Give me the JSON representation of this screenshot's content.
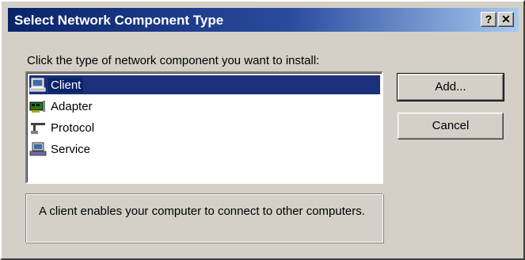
{
  "window": {
    "title": "Select Network Component Type",
    "help_label": "?",
    "close_label": "✕"
  },
  "prompt": "Click the type of network component you want to install:",
  "components": [
    {
      "label": "Client",
      "icon": "client-icon",
      "selected": true
    },
    {
      "label": "Adapter",
      "icon": "adapter-icon",
      "selected": false
    },
    {
      "label": "Protocol",
      "icon": "protocol-icon",
      "selected": false
    },
    {
      "label": "Service",
      "icon": "service-icon",
      "selected": false
    }
  ],
  "buttons": {
    "add_label": "Add...",
    "cancel_label": "Cancel"
  },
  "description": "A client enables your computer to connect to other computers.",
  "colors": {
    "titlebar_start": "#0a246a",
    "titlebar_end": "#a6caf0",
    "selection": "#0a246a",
    "face": "#d4d0c8"
  }
}
